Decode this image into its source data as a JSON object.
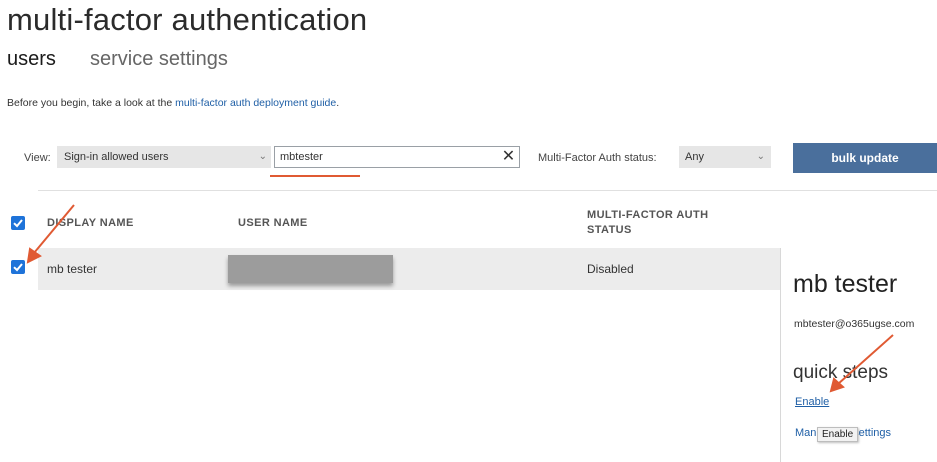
{
  "page": {
    "title": "multi-factor authentication",
    "tabs": [
      {
        "label": "users"
      },
      {
        "label": "service settings"
      }
    ],
    "intro_text": "Before you begin, take a look at the ",
    "intro_link": "multi-factor auth deployment guide",
    "intro_end": "."
  },
  "filters": {
    "view_label": "View:",
    "view_value": "Sign-in allowed users",
    "search_value": "mbtester",
    "mfa_label": "Multi-Factor Auth status:",
    "mfa_value": "Any",
    "bulk_update": "bulk update"
  },
  "table": {
    "columns": [
      "DISPLAY NAME",
      "USER NAME",
      "MULTI-FACTOR AUTH",
      "STATUS"
    ],
    "rows": [
      {
        "display_name": "mb tester",
        "user_name_redacted": true,
        "status": "Disabled",
        "checked": true
      }
    ],
    "header_checked": true
  },
  "detail": {
    "name": "mb tester",
    "email": "mbtester@o365ugse.com",
    "quick_steps": "quick steps",
    "enable": "Enable",
    "manage_prefix": "Man",
    "manage_suffix": "r settings",
    "tooltip": "Enable"
  },
  "colors": {
    "accent_blue": "#1e73d9",
    "button_bg": "#4a6f9c",
    "annotation_red": "#e05a33",
    "link": "#1f5fa6"
  },
  "icons": {
    "clear": "close-icon",
    "dropdown": "chevron-down-icon",
    "check": "checkmark-icon"
  }
}
